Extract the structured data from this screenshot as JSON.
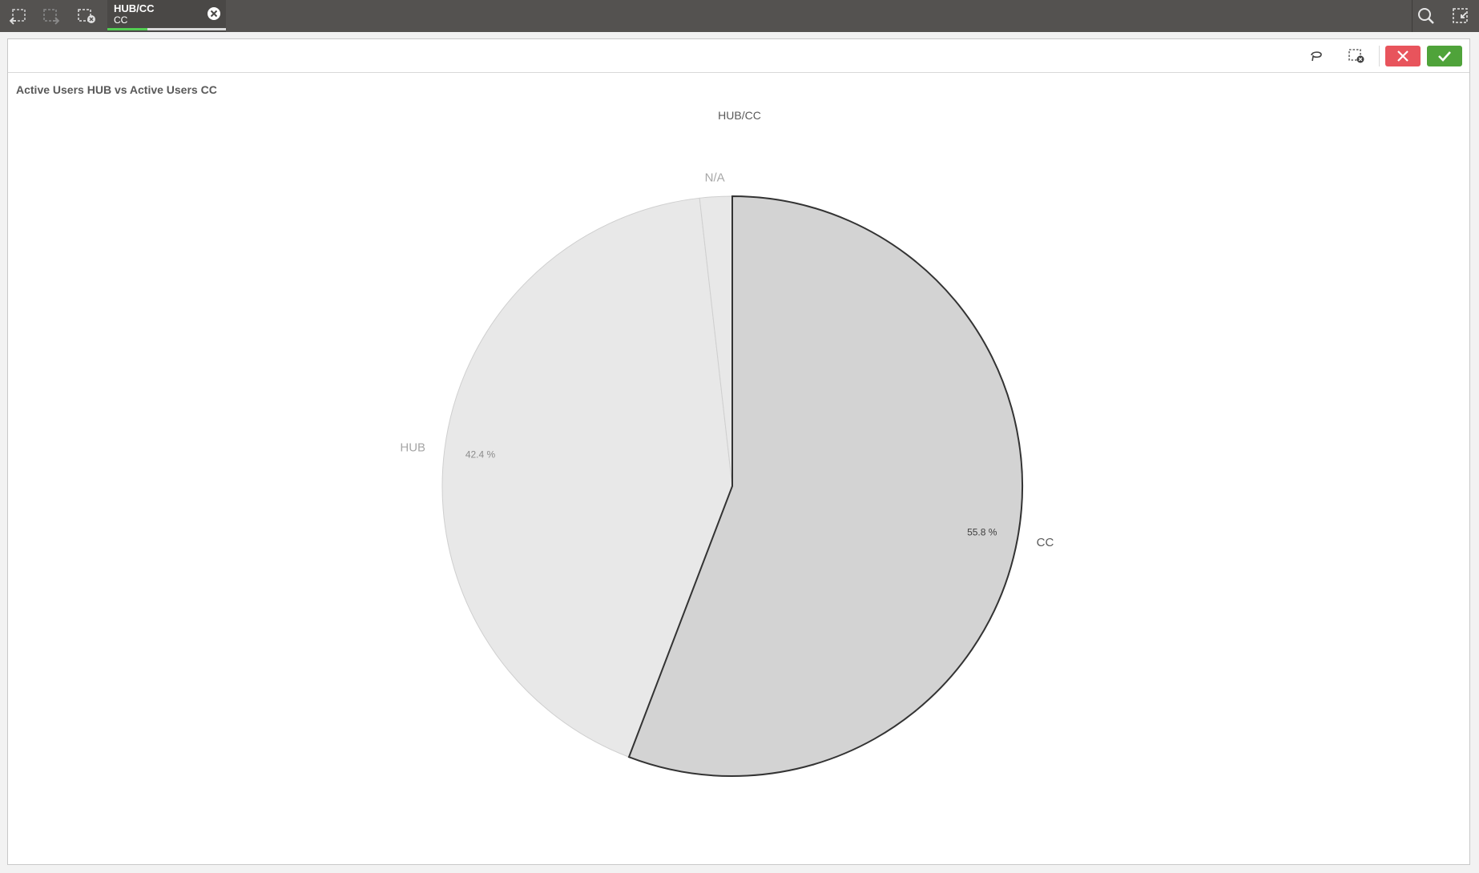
{
  "toolbar": {
    "icons": [
      "step-back-icon",
      "step-forward-icon",
      "clear-all-selections-icon",
      "search-icon",
      "selections-tool-icon"
    ]
  },
  "selection": {
    "field": "HUB/CC",
    "value": "CC",
    "selected_fraction": 0.34
  },
  "panel_toolbar": {
    "icons": [
      "lasso-icon",
      "clear-selection-icon",
      "cancel-selection-icon",
      "confirm-selection-icon"
    ],
    "cancel_color": "#e8545c",
    "confirm_color": "#4fa33a"
  },
  "chart_data": {
    "type": "pie",
    "title": "Active Users HUB vs Active Users CC",
    "dimension_label": "HUB/CC",
    "slices": [
      {
        "name": "CC",
        "value": 55.8,
        "label": "55.8 %",
        "color": "#d3d3d3",
        "selected": true
      },
      {
        "name": "HUB",
        "value": 42.4,
        "label": "42.4 %",
        "color": "#e8e8e8",
        "selected": false
      },
      {
        "name": "N/A",
        "value": 1.8,
        "label": "",
        "color": "#e8e8e8",
        "selected": false
      }
    ],
    "legend": "none",
    "start_angle": "top"
  }
}
